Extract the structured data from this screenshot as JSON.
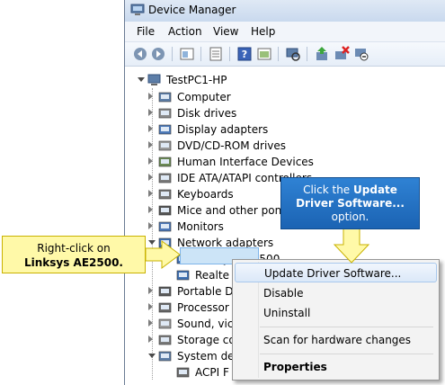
{
  "window": {
    "title": "Device Manager"
  },
  "menu": [
    "File",
    "Action",
    "View",
    "Help"
  ],
  "toolbar": [
    "back-icon",
    "forward-icon",
    "properties-icon",
    "scan-icon",
    "help-icon",
    "view-icon",
    "computer-icon",
    "update-driver-icon",
    "uninstall-icon",
    "disable-icon"
  ],
  "tree": {
    "root": "TestPC1-HP",
    "items": [
      "Computer",
      "Disk drives",
      "Display adapters",
      "DVD/CD-ROM drives",
      "Human Interface Devices",
      "IDE ATA/ATAPI controllers",
      "Keyboards",
      "Mice and other pon",
      "Monitors",
      "Network adapters",
      "Linksys AE2500",
      "Realte",
      "Portable D",
      "Processor",
      "Sound, vic",
      "Storage co",
      "System de",
      "ACPI F"
    ]
  },
  "context_menu": {
    "update": "Update Driver Software...",
    "disable": "Disable",
    "uninstall": "Uninstall",
    "scan": "Scan for hardware changes",
    "properties": "Properties"
  },
  "callout_blue": {
    "line1a": "Click the",
    "line1b": "Update",
    "line2": "Driver Software...",
    "line3": "option."
  },
  "callout_yellow": {
    "line1": "Right-click on",
    "line2": "Linksys AE2500."
  },
  "colors": {
    "accent": "#1b63b3",
    "highlight": "#fff9a8",
    "selection": "#cce4f7"
  }
}
